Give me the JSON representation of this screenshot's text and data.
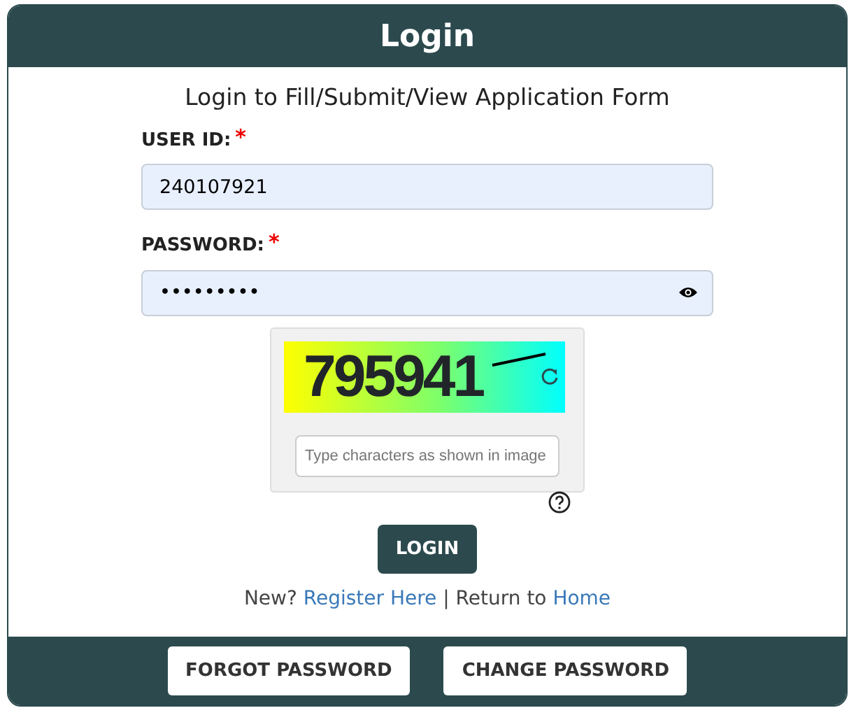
{
  "header": {
    "title": "Login"
  },
  "subtitle": "Login to Fill/Submit/View Application Form",
  "fields": [
    {
      "label": "USER ID:",
      "required_mark": "*",
      "value": "240107921",
      "kind": "text"
    },
    {
      "label": "PASSWORD:",
      "required_mark": "*",
      "value": "•••••••••",
      "kind": "password"
    }
  ],
  "captcha": {
    "code": "795941",
    "placeholder": "Type characters as shown in image"
  },
  "login_button": "LOGIN",
  "links": {
    "prefix": "New?",
    "register": "Register Here",
    "separator": "|",
    "middle": "Return to",
    "home": "Home"
  },
  "footer_buttons": [
    "FORGOT PASSWORD",
    "CHANGE PASSWORD"
  ]
}
